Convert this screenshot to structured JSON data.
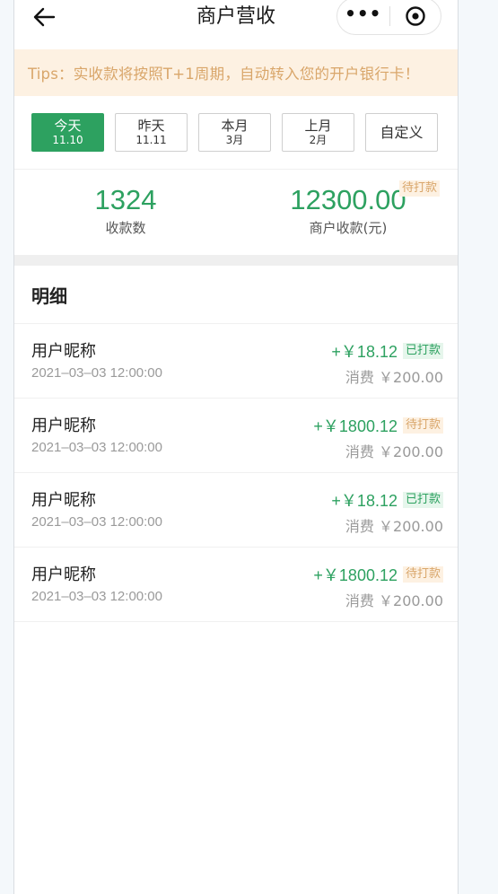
{
  "nav": {
    "title": "商户营收",
    "more_icon": "•••"
  },
  "tips": "Tips：实收款将按照T+1周期，自动转入您的开户银行卡！",
  "date_tabs": [
    {
      "line1": "今天",
      "line2": "11.10",
      "active": true
    },
    {
      "line1": "昨天",
      "line2": "11.11",
      "active": false
    },
    {
      "line1": "本月",
      "line2": "3月",
      "active": false
    },
    {
      "line1": "上月",
      "line2": "2月",
      "active": false
    },
    {
      "line1": "自定义",
      "line2": "",
      "active": false
    }
  ],
  "summary": {
    "count_value": "1324",
    "count_label": "收款数",
    "amount_value": "12300.00",
    "amount_label": "商户收款(元)",
    "amount_badge": "待打款"
  },
  "section_title": "明细",
  "records": [
    {
      "name": "用户昵称",
      "time": "2021–03–03  12:00:00",
      "amount": "+￥18.12",
      "status": "已打款",
      "status_type": "done",
      "consume": "消费 ￥200.00"
    },
    {
      "name": "用户昵称",
      "time": "2021–03–03  12:00:00",
      "amount": "+￥1800.12",
      "status": "待打款",
      "status_type": "pending",
      "consume": "消费 ￥200.00"
    },
    {
      "name": "用户昵称",
      "time": "2021–03–03  12:00:00",
      "amount": "+￥18.12",
      "status": "已打款",
      "status_type": "done",
      "consume": "消费 ￥200.00"
    },
    {
      "name": "用户昵称",
      "time": "2021–03–03  12:00:00",
      "amount": "+￥1800.12",
      "status": "待打款",
      "status_type": "pending",
      "consume": "消费 ￥200.00"
    }
  ],
  "colors": {
    "accent": "#2da160",
    "tips_bg": "#fdf1e2",
    "tips_text": "#d9a66a"
  }
}
